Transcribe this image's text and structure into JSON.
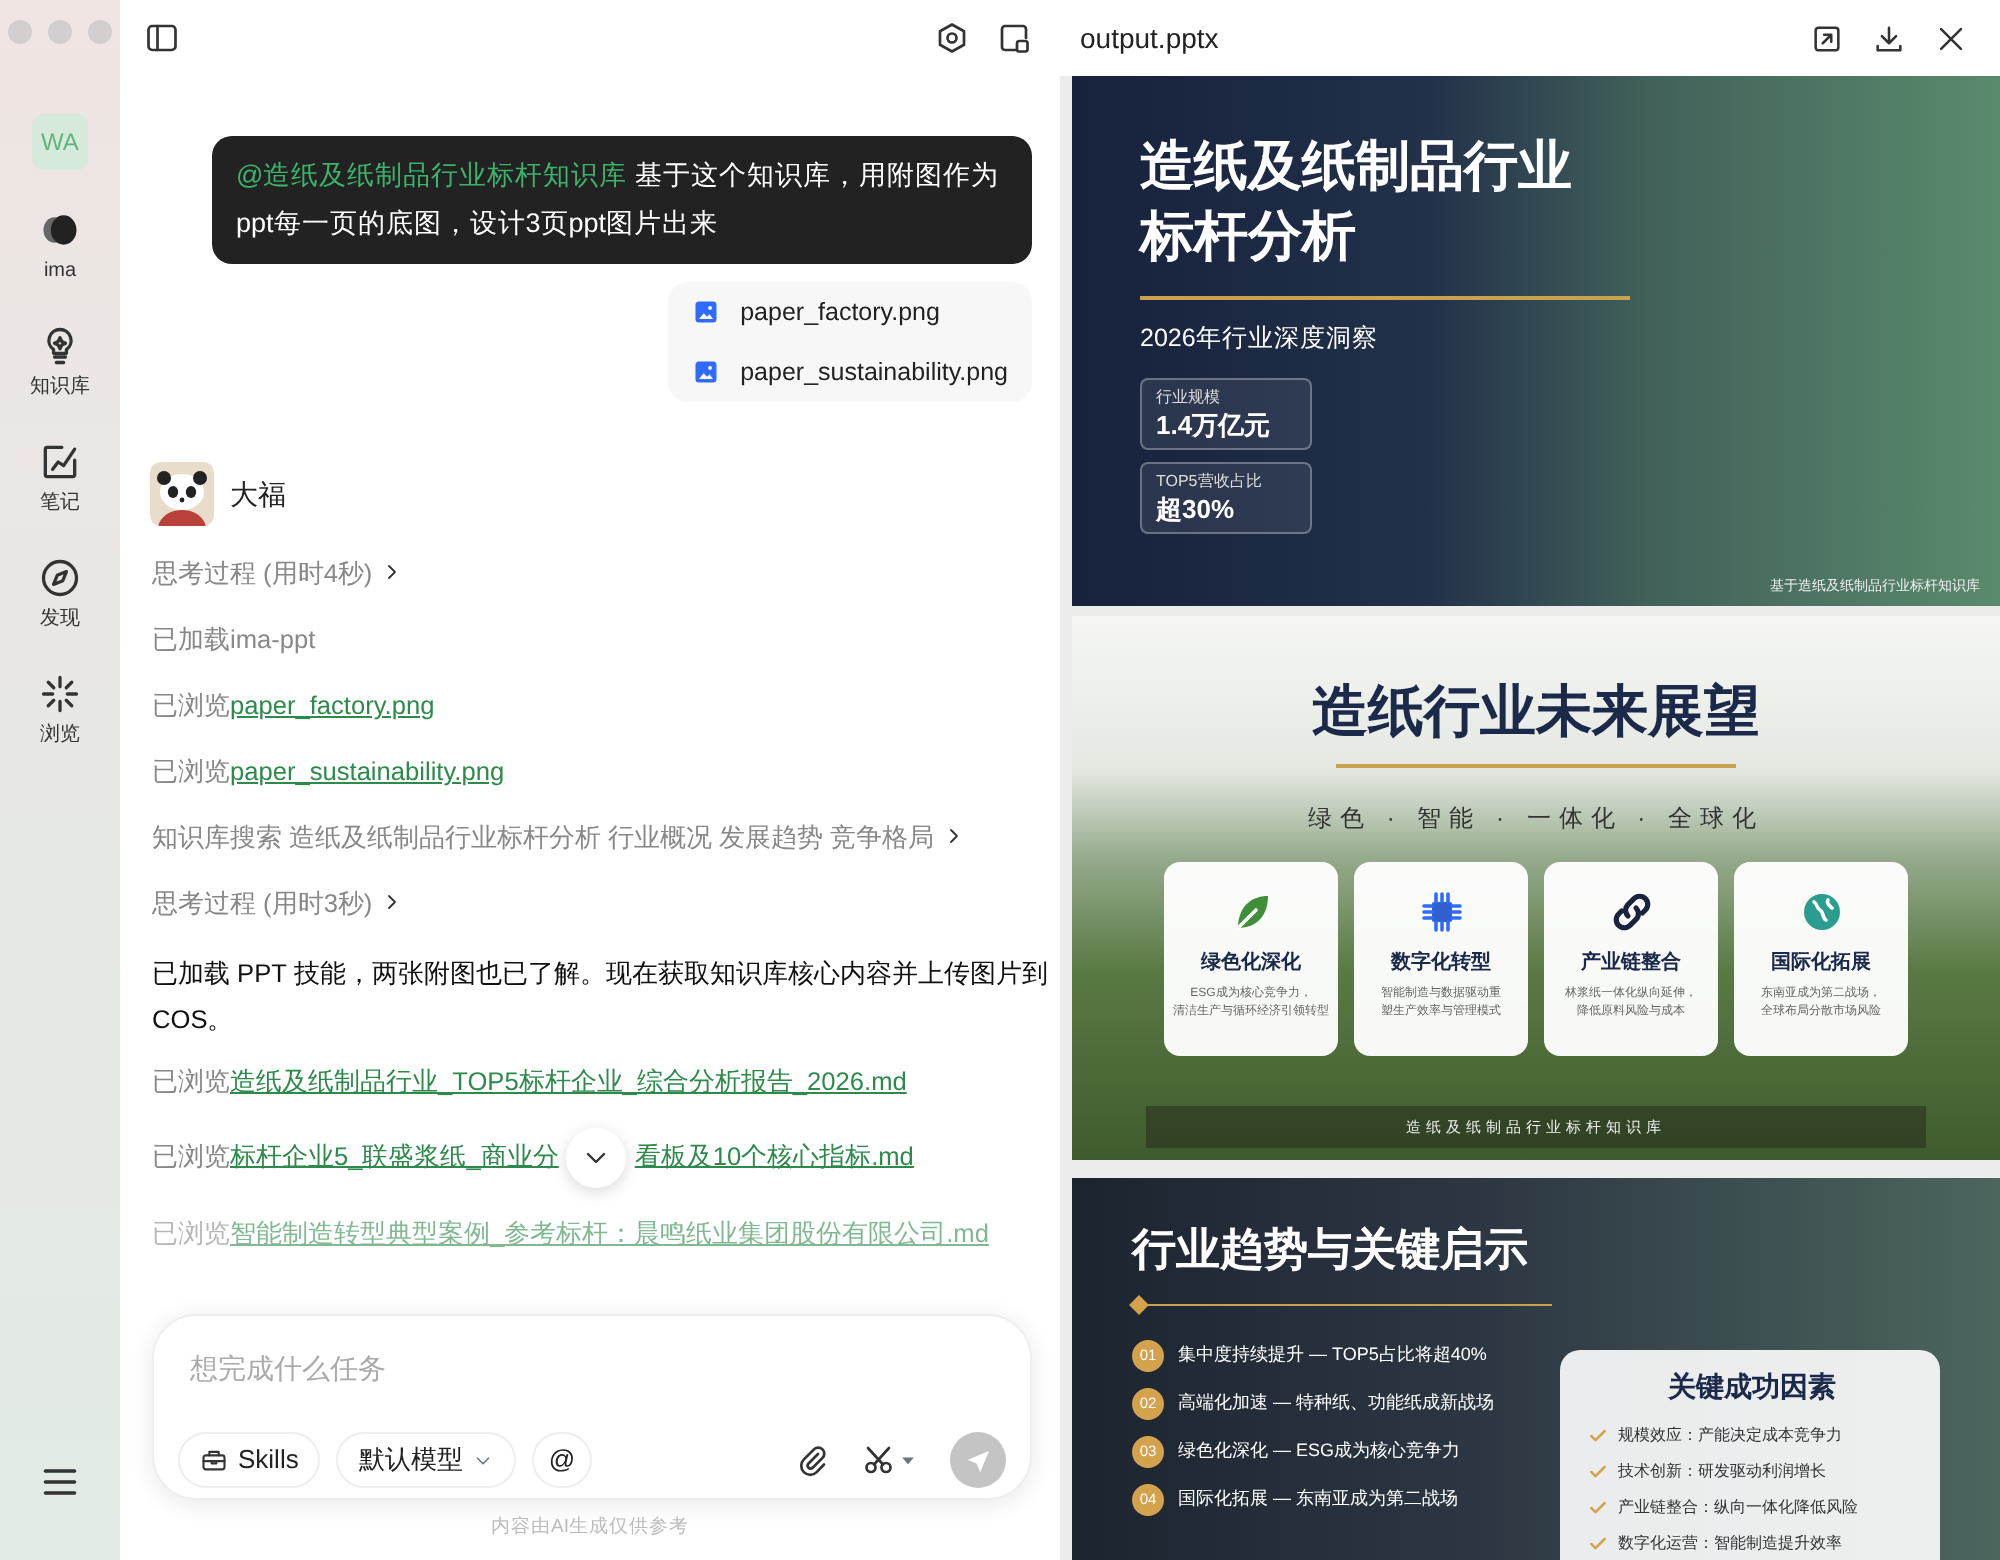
{
  "sidebar": {
    "avatar": "WA",
    "items": [
      {
        "kind": "ima",
        "label": "ima"
      },
      {
        "kind": "knowledge",
        "label": "知识库"
      },
      {
        "kind": "notes",
        "label": "笔记"
      },
      {
        "kind": "discover",
        "label": "发现"
      },
      {
        "kind": "browse",
        "label": "浏览"
      }
    ]
  },
  "chat": {
    "user_message": {
      "mention": "@造纸及纸制品行业标杆知识库",
      "text": "基于这个知识库，用附图作为ppt每一页的底图，设计3页ppt图片出来"
    },
    "attachments": [
      "paper_factory.png",
      "paper_sustainability.png"
    ],
    "assistant": {
      "name": "大福"
    },
    "items": [
      {
        "kind": "step",
        "text": "思考过程 (用时4秒)",
        "faded": false
      },
      {
        "kind": "note",
        "text": "已加载ima-ppt",
        "faded": false
      },
      {
        "kind": "browse",
        "text": "已浏览",
        "link": "paper_factory.png",
        "faded": false
      },
      {
        "kind": "browse",
        "text": "已浏览",
        "link": "paper_sustainability.png",
        "faded": false
      },
      {
        "kind": "step",
        "text": "知识库搜索 造纸及纸制品行业标杆分析 行业概况 发展趋势 竞争格局",
        "faded": false
      },
      {
        "kind": "step",
        "text": "思考过程 (用时3秒)",
        "faded": false
      },
      {
        "kind": "message",
        "text": "已加载 PPT 技能，两张附图也已了解。现在获取知识库核心内容并上传图片到 COS。",
        "faded": false
      },
      {
        "kind": "browse",
        "text": "已浏览",
        "link": "造纸及纸制品行业_TOP5标杆企业_综合分析报告_2026.md",
        "faded": false
      },
      {
        "kind": "browse",
        "text": "已浏览",
        "link": "标杆企业5_联盛浆纸_商业分",
        "link_tail": "看板及10个核心指标.md",
        "faded": false
      },
      {
        "kind": "browse",
        "text": "已浏览",
        "link": "智能制造转型典型案例_参考标杆：晨鸣纸业集团股份有限公司.md",
        "faded": true
      }
    ]
  },
  "composer": {
    "placeholder": "想完成什么任务",
    "skills": "Skills",
    "model": "默认模型",
    "mention": "@",
    "send_disabled": true,
    "disclaimer": "内容由AI生成仅供参考"
  },
  "viewer": {
    "title": "output.pptx",
    "slides": [
      {
        "kind": "cover",
        "title_lines": [
          "造纸及纸制品行业",
          "标杆分析"
        ],
        "subtitle": "2026年行业深度洞察",
        "stats": [
          {
            "label": "行业规模",
            "value": "1.4万亿元"
          },
          {
            "label": "TOP5营收占比",
            "value": "超30%"
          }
        ],
        "footer": "基于造纸及纸制品行业标杆知识库"
      },
      {
        "kind": "outlook",
        "title": "造纸行业未来展望",
        "subtitle": "绿色 · 智能 · 一体化 · 全球化",
        "cards": [
          {
            "kind": "leaf",
            "title": "绿色化深化",
            "desc": [
              "ESG成为核心竞争力，",
              "清洁生产与循环经济引领转型"
            ]
          },
          {
            "kind": "chip",
            "title": "数字化转型",
            "desc": [
              "智能制造与数据驱动重",
              "塑生产效率与管理模式"
            ]
          },
          {
            "kind": "link",
            "title": "产业链整合",
            "desc": [
              "林浆纸一体化纵向延伸，",
              "降低原料风险与成本"
            ]
          },
          {
            "kind": "globe",
            "title": "国际化拓展",
            "desc": [
              "东南亚成为第二战场，",
              "全球布局分散市场风险"
            ]
          }
        ],
        "footer": "造纸及纸制品行业标杆知识库"
      },
      {
        "kind": "trends",
        "title": "行业趋势与关键启示",
        "trends": [
          {
            "num": "01",
            "text": "集中度持续提升 — TOP5占比将超40%"
          },
          {
            "num": "02",
            "text": "高端化加速 — 特种纸、功能纸成新战场"
          },
          {
            "num": "03",
            "text": "绿色化深化 — ESG成为核心竞争力"
          },
          {
            "num": "04",
            "text": "国际化拓展 — 东南亚成为第二战场"
          }
        ],
        "panel": {
          "title": "关键成功因素",
          "items": [
            "规模效应：产能决定成本竞争力",
            "技术创新：研发驱动利润增长",
            "产业链整合：纵向一体化降低风险",
            "数字化运营：智能制造提升效率"
          ]
        }
      }
    ]
  }
}
